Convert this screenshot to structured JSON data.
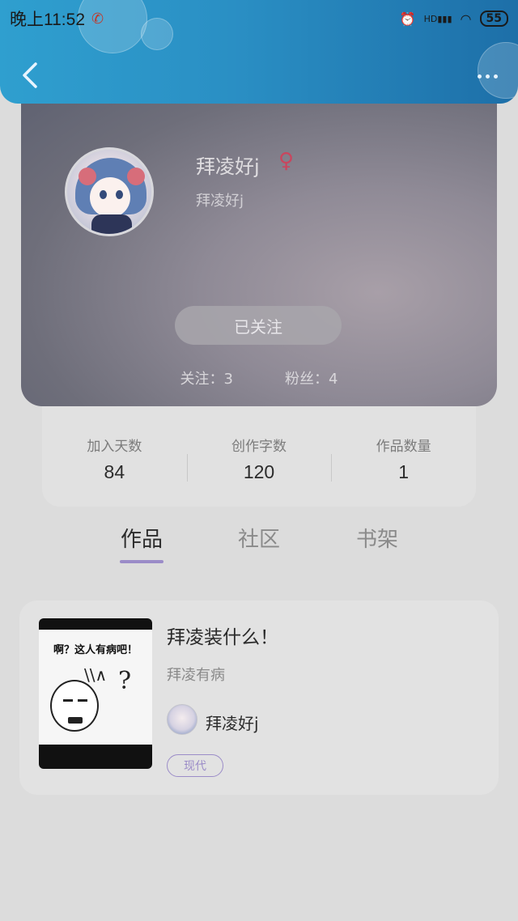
{
  "statusbar": {
    "time": "晚上11:52",
    "call_icon": "phone-icon",
    "battery": "55",
    "hd_label": "HD"
  },
  "header": {
    "back_icon": "chevron-left-icon",
    "more_icon": "more-dots-icon"
  },
  "profile": {
    "nickname": "拜凌好j",
    "gender_symbol": "♀",
    "subtitle": "拜凌好j",
    "follow_button": "已关注",
    "following": "关注：3",
    "followers": "粉丝：4"
  },
  "stats": [
    {
      "label": "加入天数",
      "value": "84"
    },
    {
      "label": "创作字数",
      "value": "120"
    },
    {
      "label": "作品数量",
      "value": "1"
    }
  ],
  "tabs": [
    {
      "label": "作品",
      "active": true
    },
    {
      "label": "社区",
      "active": false
    },
    {
      "label": "书架",
      "active": false
    }
  ],
  "works": [
    {
      "cover_text": "啊？这人有病吧！",
      "title": "拜凌装什么！",
      "description": "拜凌有病",
      "author": "拜凌好j",
      "tag": "现代"
    }
  ],
  "colors": {
    "accent": "#9b8cc8",
    "header_start": "#2f9fcf",
    "header_end": "#1d6fa8",
    "gender": "#c9465e"
  }
}
